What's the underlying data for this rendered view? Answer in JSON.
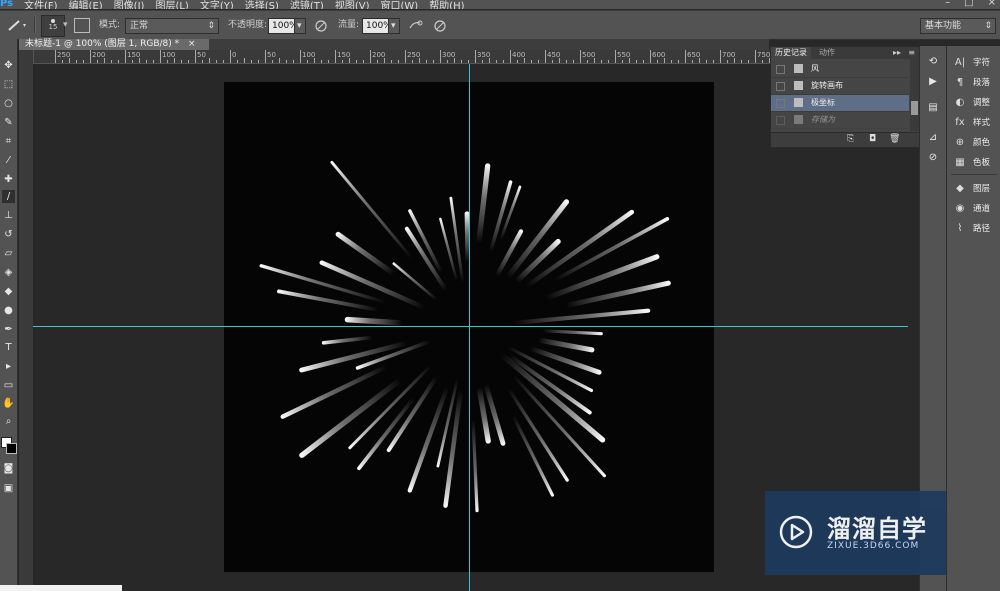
{
  "menubar": {
    "logo": "Ps",
    "items": [
      "文件(F)",
      "编辑(E)",
      "图像(I)",
      "图层(L)",
      "文字(Y)",
      "选择(S)",
      "滤镜(T)",
      "视图(V)",
      "窗口(W)",
      "帮助(H)"
    ],
    "window_controls": [
      "–",
      "□",
      "×"
    ]
  },
  "options": {
    "brush_size": "15",
    "mode_label": "模式:",
    "mode_value": "正常",
    "opacity_label": "不透明度:",
    "opacity_value": "100%",
    "flow_label": "流量:",
    "flow_value": "100%",
    "workspace": "基本功能"
  },
  "document": {
    "tab_title": "未标题-1 @ 100% (图层 1, RGB/8) *",
    "close": "×"
  },
  "ruler": {
    "labels": [
      "250",
      "200",
      "150",
      "100",
      "50",
      "0",
      "50",
      "100",
      "150",
      "200",
      "250",
      "300",
      "350",
      "400",
      "450",
      "500",
      "550",
      "600",
      "650",
      "700",
      "750"
    ]
  },
  "history": {
    "tabs": [
      "历史记录",
      "动作"
    ],
    "rows": [
      {
        "label": "风"
      },
      {
        "label": "旋转画布"
      },
      {
        "label": "极坐标"
      },
      {
        "label": "存储为"
      }
    ]
  },
  "right_panel": {
    "items": [
      {
        "icon": "A|",
        "label": "字符"
      },
      {
        "icon": "¶",
        "label": "段落"
      },
      {
        "icon": "◐",
        "label": "调整"
      },
      {
        "icon": "fx",
        "label": "样式"
      },
      {
        "icon": "⊕",
        "label": "颜色"
      },
      {
        "icon": "▦",
        "label": "色板"
      },
      {
        "icon": "◆",
        "label": "图层"
      },
      {
        "icon": "◉",
        "label": "通道"
      },
      {
        "icon": "⌇",
        "label": "路径"
      }
    ]
  },
  "watermark": {
    "title": "溜溜自学",
    "url": "ZIXUE.3D66.COM"
  },
  "colors": {
    "guide": "#32c8d8",
    "panel": "#535353",
    "canvas_bg": "#282828"
  }
}
